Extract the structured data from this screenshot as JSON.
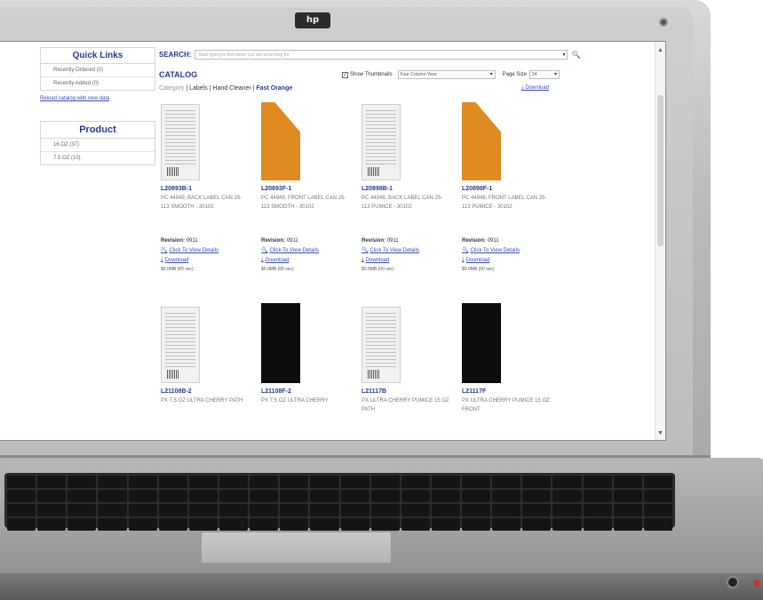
{
  "laptop": {
    "brand_logo": "hp"
  },
  "sidebar": {
    "quick_links_title": "Quick Links",
    "quick_links": [
      "Recently Ordered (0)",
      "Recently Added (0)"
    ],
    "reload_link": "Reload catalog with new data",
    "product_title": "Product",
    "products": [
      "16 OZ (37)",
      "7.5 OZ (10)"
    ]
  },
  "search": {
    "label": "SEARCH:",
    "placeholder": "Start typing to find items you are searching for"
  },
  "catalog": {
    "title": "CATALOG",
    "show_thumbnails_label": "Show Thumbnails",
    "show_thumbnails_checked": true,
    "view_select": "Four Column View",
    "page_size_label": "Page Size",
    "page_size_value": "24",
    "breadcrumb": [
      "Category",
      "Labels",
      "Hand Cleaner",
      "Fast Orange"
    ],
    "download_label": "Download"
  },
  "items": [
    {
      "code": "L20893B-1",
      "desc": "PC 44949, BACK LABEL CAN 25-113 SMOOTH - 30102",
      "thumb": "label",
      "revision": "0911",
      "view": "Click To View Details",
      "download": "Download",
      "size": "$0.0MB (00 sec)"
    },
    {
      "code": "L20893F-1",
      "desc": "PC 44949, FRONT LABEL CAN 25-113 SMOOTH - 30102",
      "thumb": "orange",
      "revision": "0911",
      "view": "Click To View Details",
      "download": "Download",
      "size": "$0.0MB (00 sec)"
    },
    {
      "code": "L20898B-1",
      "desc": "PC 44948, BACK LABEL CAN 25-113 PUMICE - 30102",
      "thumb": "label",
      "revision": "0911",
      "view": "Click To View Details",
      "download": "Download",
      "size": "$0.0MB (00 sec)"
    },
    {
      "code": "L20898F-1",
      "desc": "PC 44948, FRONT LABEL CAN 25-113 PUMICE - 30102",
      "thumb": "orange",
      "revision": "0911",
      "view": "Click To View Details",
      "download": "Download",
      "size": "$0.0MB (00 sec)"
    },
    {
      "code": "L21108B-2",
      "desc": "PX 7.5 OZ ULTRA CHERRY PATH",
      "thumb": "label",
      "revision": "",
      "view": "",
      "download": "",
      "size": ""
    },
    {
      "code": "L21108F-2",
      "desc": "PX 7.5 OZ ULTRA CHERRY",
      "thumb": "black",
      "revision": "",
      "view": "",
      "download": "",
      "size": ""
    },
    {
      "code": "L21117B",
      "desc": "PX ULTRA CHERRY PUMICE 15 OZ PATH",
      "thumb": "label",
      "revision": "",
      "view": "",
      "download": "",
      "size": ""
    },
    {
      "code": "L21117F",
      "desc": "PX ULTRA CHERRY PUMICE 15 OZ FRONT",
      "thumb": "black",
      "revision": "",
      "view": "",
      "download": "",
      "size": ""
    }
  ],
  "labels": {
    "revision": "Revision:"
  },
  "colors": {
    "accent": "#2b3a8f",
    "link": "#3a4ab8",
    "orange": "#e08a22"
  }
}
